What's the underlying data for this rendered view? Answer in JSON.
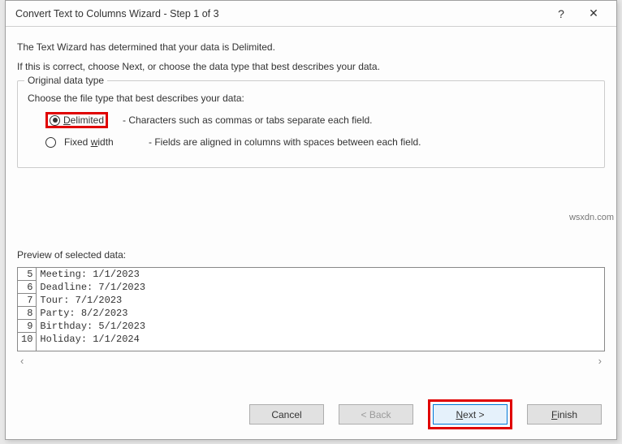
{
  "titlebar": {
    "title": "Convert Text to Columns Wizard - Step 1 of 3",
    "help": "?",
    "close": "✕"
  },
  "intro": {
    "line1": "The Text Wizard has determined that your data is Delimited.",
    "line2": "If this is correct, choose Next, or choose the data type that best describes your data."
  },
  "fieldset": {
    "legend": "Original data type",
    "choose": "Choose the file type that best describes your data:",
    "delimited": {
      "label_pre": "D",
      "label_rest": "elimited",
      "desc": "-  Characters such as commas or tabs separate each field."
    },
    "fixed": {
      "label_pre": "Fixed ",
      "label_u": "w",
      "label_post": "idth",
      "desc": "-  Fields are aligned in columns with spaces between each field."
    }
  },
  "preview": {
    "title": "Preview of selected data:",
    "rows": [
      {
        "num": "5",
        "text": "Meeting: 1/1/2023"
      },
      {
        "num": "6",
        "text": "Deadline: 7/1/2023"
      },
      {
        "num": "7",
        "text": "Tour: 7/1/2023"
      },
      {
        "num": "8",
        "text": "Party: 8/2/2023"
      },
      {
        "num": "9",
        "text": "Birthday: 5/1/2023"
      },
      {
        "num": "10",
        "text": "Holiday: 1/1/2024"
      }
    ],
    "scroll_left": "‹",
    "scroll_right": "›"
  },
  "buttons": {
    "cancel": "Cancel",
    "back": "< Back",
    "next_u": "N",
    "next_rest": "ext >",
    "finish_u": "F",
    "finish_rest": "inish"
  },
  "watermark": "wsxdn.com"
}
